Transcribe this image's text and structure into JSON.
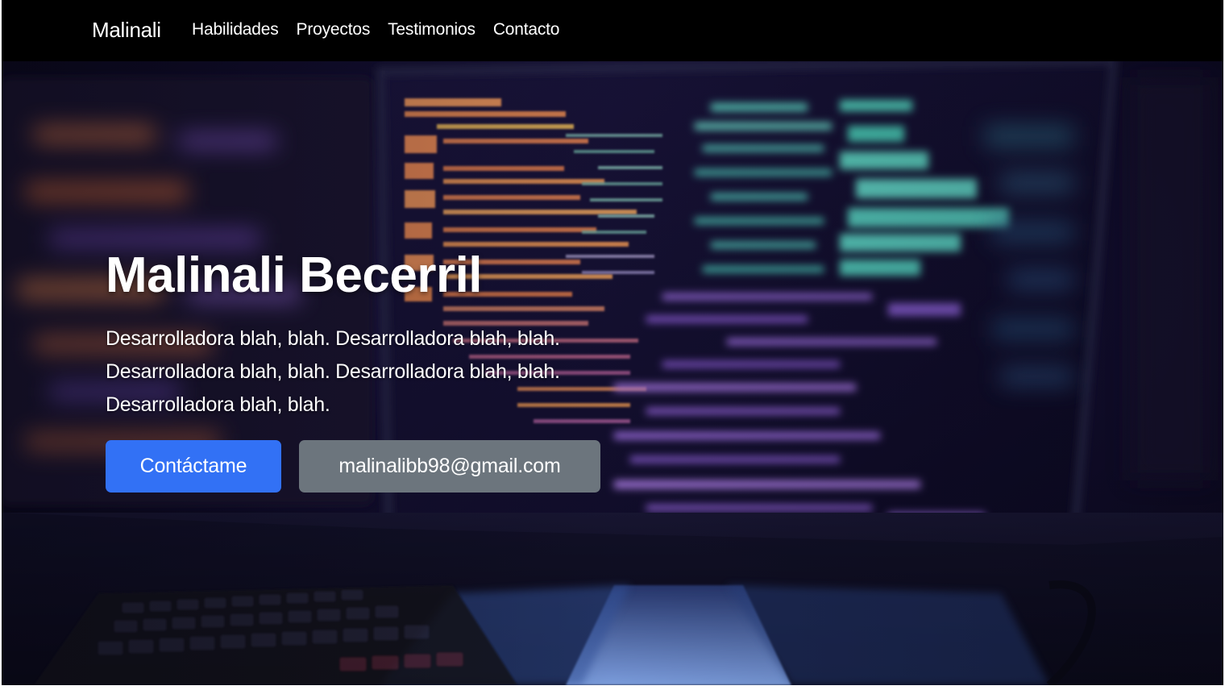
{
  "navbar": {
    "brand": "Malinali",
    "links": [
      "Habilidades",
      "Proyectos",
      "Testimonios",
      "Contacto"
    ]
  },
  "hero": {
    "title": "Malinali Becerril",
    "description": "Desarrolladora blah, blah. Desarrolladora blah, blah. Desarrolladora blah, blah. Desarrolladora blah, blah. Desarrolladora blah, blah.",
    "primary_button": "Contáctame",
    "secondary_button": "malinalibb98@gmail.com"
  },
  "colors": {
    "navbar_bg": "#000000",
    "primary": "#3271f5",
    "secondary": "#6c757d",
    "text": "#ffffff"
  }
}
